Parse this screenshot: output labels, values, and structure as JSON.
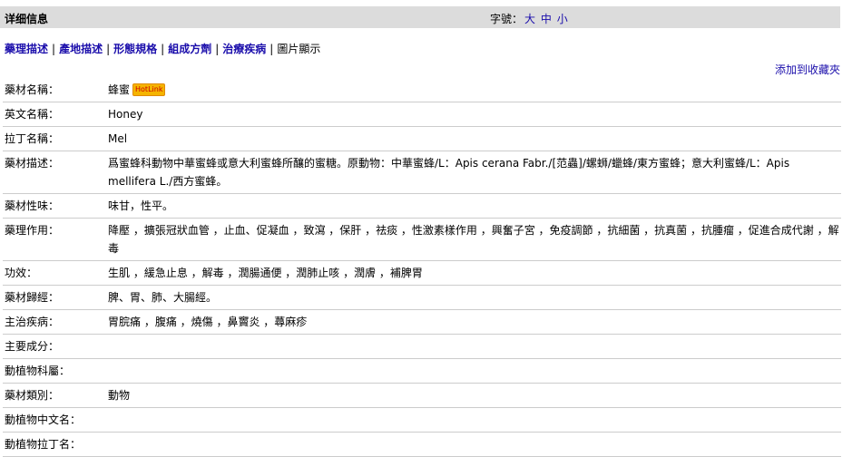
{
  "header": {
    "title": "详细信息",
    "fontsize_label": "字號：",
    "sizes": [
      "大",
      "中",
      "小"
    ]
  },
  "tabs": {
    "items": [
      "藥理描述",
      "產地描述",
      "形態規格",
      "組成方劑",
      "治療疾病"
    ],
    "last": "圖片顯示"
  },
  "favorite_label": "添加到收藏夾",
  "hotlink_label": "HotLink",
  "rows": [
    {
      "label": "藥材名稱：",
      "value": "蜂蜜"
    },
    {
      "label": "英文名稱：",
      "value": "Honey"
    },
    {
      "label": "拉丁名稱：",
      "value": "Mel"
    },
    {
      "label": "藥材描述：",
      "value": "爲蜜蜂科動物中華蜜蜂或意大利蜜蜂所釀的蜜糖。原動物：中華蜜蜂/L：Apis cerana Fabr./[范蟲]/螺蛳/蠟蜂/東方蜜蜂；意大利蜜蜂/L：Apis mellifera L./西方蜜蜂。"
    },
    {
      "label": "藥材性味：",
      "value": "味甘，性平。"
    },
    {
      "label": "藥理作用：",
      "value": "降壓 ，擴張冠狀血管 ，止血、促凝血 ，致瀉 ，保肝 ，祛痰 ，性激素樣作用 ，興奮子宮 ，免疫調節 ，抗細菌 ，抗真菌 ，抗腫瘤 ，促進合成代謝 ，解毒"
    },
    {
      "label": "功效：",
      "value": "生肌 ，緩急止息 ，解毒 ，潤腸通便 ，潤肺止咳 ，潤膚 ，補脾胃"
    },
    {
      "label": "藥材歸經：",
      "value": "脾、胃、肺、大腸經。"
    },
    {
      "label": "主治疾病：",
      "value": "胃脘痛 ，腹痛 ，燒傷 ，鼻竇炎 ，蕁麻疹"
    },
    {
      "label": "主要成分：",
      "value": ""
    },
    {
      "label": "動植物科屬：",
      "value": ""
    },
    {
      "label": "藥材類別：",
      "value": "動物"
    },
    {
      "label": "動植物中文名：",
      "value": ""
    },
    {
      "label": "動植物拉丁名：",
      "value": ""
    }
  ]
}
